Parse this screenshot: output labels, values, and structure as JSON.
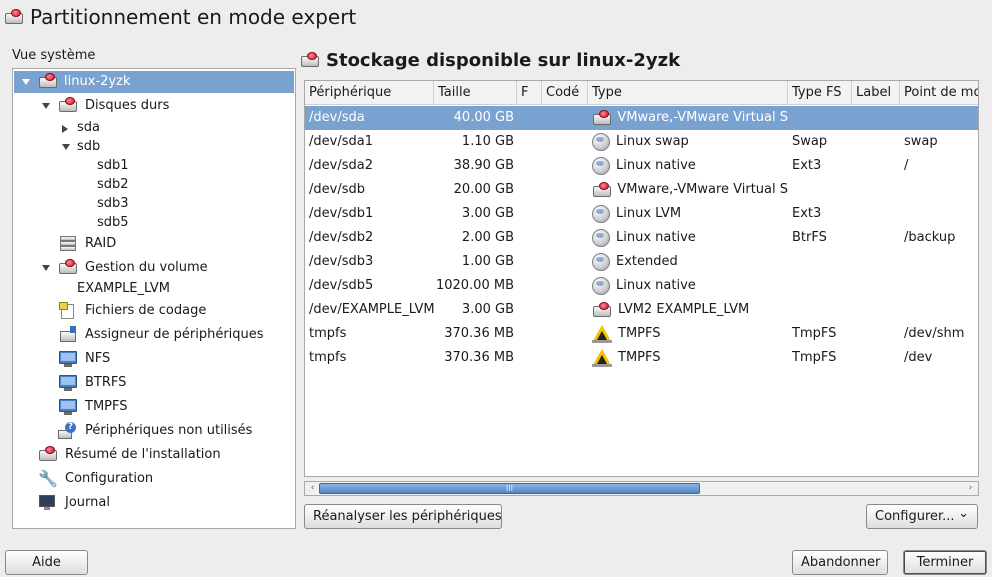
{
  "window": {
    "title": "Partitionnement en mode expert"
  },
  "tree": {
    "label": "Vue système",
    "items": [
      {
        "label": "linux-2yzk",
        "selected": true,
        "expander": "down",
        "icon": "disk-icon"
      },
      {
        "label": "Disques durs",
        "expander": "down",
        "icon": "disk-icon"
      },
      {
        "label": "sda",
        "expander": "right"
      },
      {
        "label": "sdb",
        "expander": "down"
      },
      {
        "label": "sdb1"
      },
      {
        "label": "sdb2"
      },
      {
        "label": "sdb3"
      },
      {
        "label": "sdb5"
      },
      {
        "label": "RAID",
        "icon": "raid-icon"
      },
      {
        "label": "Gestion du volume",
        "expander": "down",
        "icon": "disk-icon"
      },
      {
        "label": "EXAMPLE_LVM"
      },
      {
        "label": "Fichiers de codage",
        "icon": "document-icon"
      },
      {
        "label": "Assigneur de périphériques",
        "icon": "device-mapper-icon"
      },
      {
        "label": "NFS",
        "icon": "folder-icon"
      },
      {
        "label": "BTRFS",
        "icon": "folder-icon"
      },
      {
        "label": "TMPFS",
        "icon": "folder-icon"
      },
      {
        "label": "Périphériques non utilisés",
        "icon": "unused-devices-icon"
      },
      {
        "label": "Résumé de l'installation",
        "icon": "disk-icon"
      },
      {
        "label": "Configuration",
        "icon": "wrench-icon"
      },
      {
        "label": "Journal",
        "icon": "log-icon"
      }
    ]
  },
  "panel": {
    "title": "Stockage disponible sur linux-2yzk"
  },
  "table": {
    "columns": [
      "Périphérique",
      "Taille",
      "F",
      "Codé",
      "Type",
      "Type FS",
      "Label",
      "Point de mo"
    ],
    "rows": [
      {
        "device": "/dev/sda",
        "size": "40.00 GB",
        "type": "VMware,-VMware Virtual S",
        "fs": "",
        "mount": "",
        "icon": "disk-icon",
        "selected": true
      },
      {
        "device": "/dev/sda1",
        "size": "1.10 GB",
        "type": "Linux swap",
        "fs": "Swap",
        "mount": "swap",
        "icon": "partition-icon"
      },
      {
        "device": "/dev/sda2",
        "size": "38.90 GB",
        "type": "Linux native",
        "fs": "Ext3",
        "mount": "/",
        "icon": "partition-icon"
      },
      {
        "device": "/dev/sdb",
        "size": "20.00 GB",
        "type": "VMware,-VMware Virtual S",
        "fs": "",
        "mount": "",
        "icon": "disk-icon"
      },
      {
        "device": "/dev/sdb1",
        "size": "3.00 GB",
        "type": "Linux LVM",
        "fs": "Ext3",
        "mount": "",
        "icon": "partition-icon"
      },
      {
        "device": "/dev/sdb2",
        "size": "2.00 GB",
        "type": "Linux native",
        "fs": "BtrFS",
        "mount": "/backup",
        "icon": "partition-icon"
      },
      {
        "device": "/dev/sdb3",
        "size": "1.00 GB",
        "type": "Extended",
        "fs": "",
        "mount": "",
        "icon": "partition-icon"
      },
      {
        "device": "/dev/sdb5",
        "size": "1020.00 MB",
        "type": "Linux native",
        "fs": "",
        "mount": "",
        "icon": "partition-icon"
      },
      {
        "device": "/dev/EXAMPLE_LVM",
        "size": "3.00 GB",
        "type": "LVM2 EXAMPLE_LVM",
        "fs": "",
        "mount": "",
        "icon": "disk-icon"
      },
      {
        "device": "tmpfs",
        "size": "370.36 MB",
        "type": "TMPFS",
        "fs": "TmpFS",
        "mount": "/dev/shm",
        "icon": "tmpfs-icon"
      },
      {
        "device": "tmpfs",
        "size": "370.36 MB",
        "type": "TMPFS",
        "fs": "TmpFS",
        "mount": "/dev",
        "icon": "tmpfs-icon"
      }
    ]
  },
  "scrollbar": {
    "grip": "III"
  },
  "buttons": {
    "rescan": "Réanalyser les périphériques",
    "configure": "Configurer...",
    "configure_arrow": "⌄",
    "help": "Aide",
    "abort": "Abandonner",
    "finish": "Terminer",
    "scroll_left": "‹",
    "scroll_right": "›"
  }
}
